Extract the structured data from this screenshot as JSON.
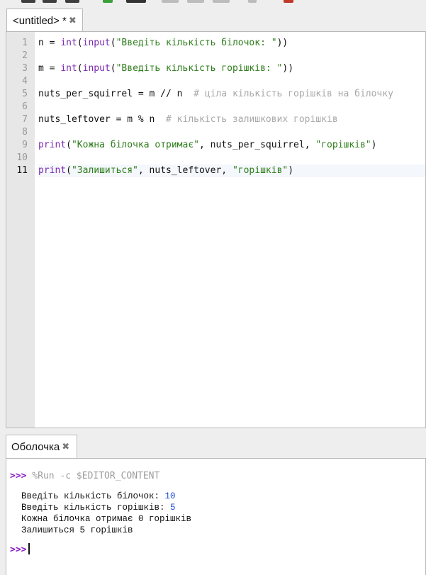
{
  "editor": {
    "tab_label": "<untitled> *",
    "close_icon": "close-icon",
    "line_numbers": [
      "1",
      "2",
      "3",
      "4",
      "5",
      "6",
      "7",
      "8",
      "9",
      "10",
      "11"
    ],
    "lines": {
      "l1": {
        "a": "n = ",
        "b": "int",
        "c": "(",
        "d": "input",
        "e": "(",
        "f": "\"Введіть кількість білочок: \"",
        "g": "))"
      },
      "l3": {
        "a": "m = ",
        "b": "int",
        "c": "(",
        "d": "input",
        "e": "(",
        "f": "\"Введіть кількість горішків: \"",
        "g": "))"
      },
      "l5": {
        "a": "nuts_per_squirrel = m // n  ",
        "comment": "# ціла кількість горішків на білочку"
      },
      "l7": {
        "a": "nuts_leftover = m % n  ",
        "comment": "# кількість залишкових горішків"
      },
      "l9": {
        "a": "print",
        "b": "(",
        "c": "\"Кожна білочка отримає\"",
        "d": ", nuts_per_squirrel, ",
        "e": "\"горішків\"",
        "f": ")"
      },
      "l11": {
        "a": "print",
        "b": "(",
        "c": "\"Залишиться\"",
        "d": ", nuts_leftover, ",
        "e": "\"горішків\"",
        "f": ")"
      }
    }
  },
  "shell": {
    "tab_label": "Оболочка",
    "prompt": ">>>",
    "run_command": " %Run -c $EDITOR_CONTENT",
    "output": {
      "o1_text": "Введіть кількість білочок: ",
      "o1_value": "10",
      "o2_text": "Введіть кількість горішків: ",
      "o2_value": "5",
      "o3": "Кожна білочка отримає 0 горішків",
      "o4": "Залишиться 5 горішків"
    }
  },
  "colors": {
    "builtin": "#7b2bb0",
    "string": "#2e7d1c",
    "comment": "#a8a8a8",
    "prompt": "#8a1cc4",
    "input_value": "#1f4fd1"
  }
}
